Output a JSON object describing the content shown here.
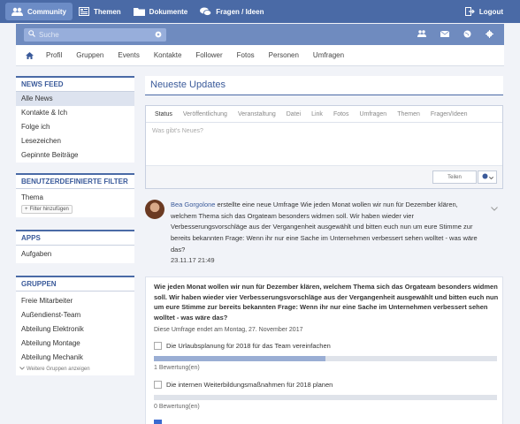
{
  "topnav": {
    "items": [
      {
        "label": "Community",
        "icon": "community-icon",
        "active": true
      },
      {
        "label": "Themen",
        "icon": "topics-icon",
        "active": false
      },
      {
        "label": "Dokumente",
        "icon": "folder-icon",
        "active": false
      },
      {
        "label": "Fragen / Ideen",
        "icon": "chat-icon",
        "active": false
      }
    ],
    "logout": "Logout"
  },
  "search": {
    "placeholder": "Suche"
  },
  "subnav": {
    "items": [
      "Profil",
      "Gruppen",
      "Events",
      "Kontakte",
      "Follower",
      "Fotos",
      "Personen",
      "Umfragen"
    ]
  },
  "sidebar": {
    "newsfeed": {
      "title": "NEWS FEED",
      "items": [
        "Alle News",
        "Kontakte & Ich",
        "Folge ich",
        "Lesezeichen",
        "Gepinnte Beiträge"
      ]
    },
    "filter": {
      "title": "BENUTZERDEFINIERTE FILTER",
      "items": [
        "Thema"
      ],
      "add_label": "Filter hinzufügen"
    },
    "apps": {
      "title": "APPS",
      "items": [
        "Aufgaben"
      ]
    },
    "groups": {
      "title": "GRUPPEN",
      "items": [
        "Freie Mitarbeiter",
        "Außendienst-Team",
        "Abteilung Elektronik",
        "Abteilung Montage",
        "Abteilung Mechanik"
      ],
      "more_label": "Weitere Gruppen anzeigen"
    }
  },
  "main": {
    "title": "Neueste Updates",
    "composer": {
      "tabs": [
        "Status",
        "Veröffentlichung",
        "Veranstaltung",
        "Datei",
        "Link",
        "Fotos",
        "Umfragen",
        "Themen",
        "Fragen/Ideen"
      ],
      "placeholder": "Was gibt's Neues?",
      "share_label": "Teilen"
    },
    "post": {
      "author": "Bea Gorgolone",
      "text": " erstellte eine neue Umfrage Wie jeden Monat wollen wir nun für Dezember klären, welchem Thema sich das Orgateam besonders widmen soll. Wir haben wieder vier Verbesserungsvorschläge aus der Vergangenheit ausgewählt und bitten euch nun um eure Stimme zur bereits bekannten Frage: Wenn ihr nur eine Sache im Unternehmen verbessert sehen wolltet - was wäre das?",
      "date": "23.11.17 21:49"
    },
    "poll": {
      "question": "Wie jeden Monat wollen wir nun für Dezember klären, welchem Thema sich das Orgateam besonders widmen soll. Wir haben wieder vier Verbesserungsvorschläge aus der Vergangenheit ausgewählt und bitten euch nun um eure Stimme zur bereits bekannten Frage: Wenn ihr nur eine Sache im Unternehmen verbessert sehen wolltet - was wäre das?",
      "ends": "Diese Umfrage endet am Montag, 27. November 2017",
      "options": [
        {
          "label": "Die Urlaubsplanung für 2018 für das Team vereinfachen",
          "votes": "1 Bewertung(en)",
          "fraction": 0.5,
          "checked": false
        },
        {
          "label": "Die internen Weiterbildungsmaßnahmen für 2018 planen",
          "votes": "0 Bewertung(en)",
          "fraction": 0.0,
          "checked": false
        },
        {
          "label": "",
          "votes": "",
          "fraction": 0.0,
          "checked": true
        }
      ]
    }
  },
  "colors": {
    "brand": "#4a6aa6",
    "accent": "#3a5a9a"
  }
}
